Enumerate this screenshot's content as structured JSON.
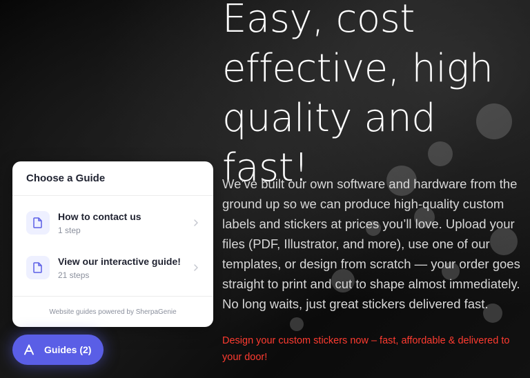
{
  "hero": {
    "headline_line1": "Easy, cost",
    "headline_line2": "effective, high",
    "headline_line3": "quality and fast!",
    "description": "We’ve built our own software and hardware from the ground up so we can produce high-quality custom labels and stickers at prices you’ll love. Upload your files (PDF, Illustrator, and more), use one of our templates, or design from scratch — your order goes straight to print and cut to shape almost immediately. No long waits, just great stickers delivered fast.",
    "cta": "Design your custom stickers now – fast, affordable & delivered to your door!"
  },
  "guide_panel": {
    "title": "Choose a Guide",
    "items": [
      {
        "name": "How to contact us",
        "steps": "1 step",
        "icon": "document-icon"
      },
      {
        "name": "View our interactive guide!",
        "steps": "21 steps",
        "icon": "document-icon"
      }
    ],
    "footer": "Website guides powered by SherpaGenie"
  },
  "launcher": {
    "label": "Guides (2)",
    "icon": "sherpagenie-logo-icon"
  },
  "colors": {
    "accent": "#5a5ee6",
    "icon_bg": "#eef0ff",
    "cta_red": "#ff3b30",
    "background": "#000000"
  }
}
